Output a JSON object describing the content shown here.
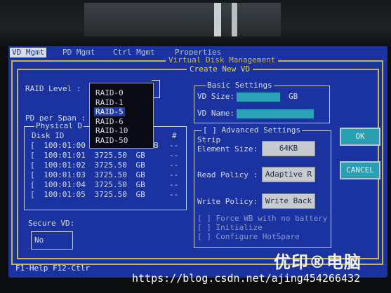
{
  "menu": {
    "items": [
      {
        "label": "VD Mgmt"
      },
      {
        "label": "PD Mgmt"
      },
      {
        "label": "Ctrl Mgmt"
      },
      {
        "label": "Properties"
      }
    ]
  },
  "frame": {
    "title": "Virtual Disk Management",
    "dialog_title": "Create New VD"
  },
  "left": {
    "raid_level_label": "RAID Level :",
    "pd_per_span_label": "PD per Span :",
    "physical_disks_title": "Physical D",
    "disk_id_header": "Disk ID",
    "hash_header": "#",
    "disks": [
      {
        "check": "[",
        "id": "100:01:00",
        "size": "",
        "unit": "B",
        "hash": "--"
      },
      {
        "check": "[",
        "id": "100:01:01",
        "size": "3725.50",
        "unit": "GB",
        "hash": "--"
      },
      {
        "check": "[",
        "id": "100:01:02",
        "size": "3725.50",
        "unit": "GB",
        "hash": "--"
      },
      {
        "check": "[",
        "id": "100:01:03",
        "size": "3725.50",
        "unit": "GB",
        "hash": "--"
      },
      {
        "check": "[",
        "id": "100:01:04",
        "size": "3725.50",
        "unit": "GB",
        "hash": "--"
      },
      {
        "check": "[",
        "id": "100:01:05",
        "size": "3725.50",
        "unit": "GB",
        "hash": "--"
      }
    ],
    "secure_vd_label": "Secure VD:",
    "secure_vd_value": "No"
  },
  "raid_dropdown": {
    "options": [
      "RAID-0",
      "RAID-1",
      "RAID-5",
      "RAID-6",
      "RAID-10",
      "RAID-50"
    ],
    "selected": "RAID-5"
  },
  "basic": {
    "title": "Basic Settings",
    "vd_size_label": "VD Size:",
    "vd_size_unit": "GB",
    "vd_name_label": "VD Name:"
  },
  "advanced": {
    "title": "[ ] Advanced Settings",
    "strip_label": "Strip",
    "element_size_label": "Element Size:",
    "element_size_value": "64KB",
    "read_policy_label": "Read Policy :",
    "read_policy_value": "Adaptive R",
    "write_policy_label": "Write Policy:",
    "write_policy_value": "Write Back",
    "options": [
      "[ ] Force WB with no battery",
      "[ ] Initialize",
      "[ ] Configure HotSpare"
    ]
  },
  "buttons": {
    "ok": "OK",
    "cancel": "CANCEL"
  },
  "footer": {
    "help": "F1-Help F12-Ctlr"
  },
  "watermark": {
    "brand": "优印®电脑",
    "url": "https://blog.csdn.net/ajing454266432"
  },
  "colors": {
    "bios_blue": "#1b33a0",
    "frame_yellow": "#c7b64a",
    "field_cyan": "#2aa3b8"
  }
}
